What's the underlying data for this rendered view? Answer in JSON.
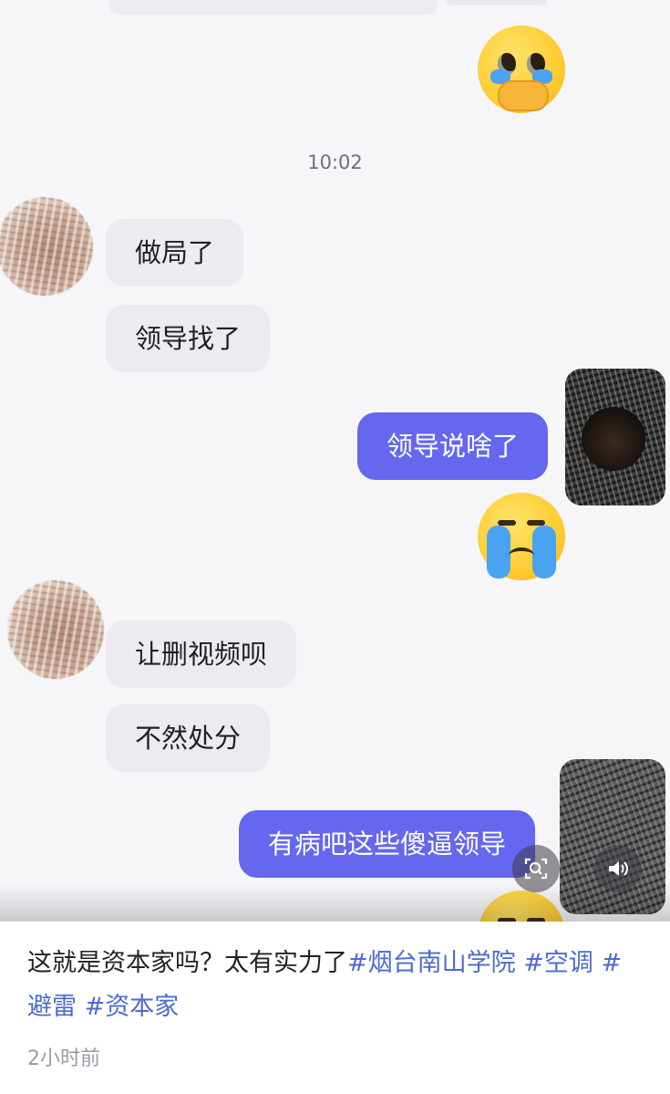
{
  "chat": {
    "timestamp": "10:02",
    "messages": [
      {
        "side": "in",
        "text": "做局了"
      },
      {
        "side": "in",
        "text": "领导找了"
      },
      {
        "side": "out",
        "text": "领导说啥了"
      },
      {
        "side": "in",
        "text": "让删视频呗"
      },
      {
        "side": "in",
        "text": "不然处分"
      },
      {
        "side": "out",
        "text": "有病吧这些傻逼领导"
      }
    ],
    "emojis": [
      "pleading-face-emoji",
      "crying-face-emoji",
      "crying-face-emoji"
    ]
  },
  "controls": {
    "lens_icon": "lens-search-icon",
    "volume_icon": "volume-icon"
  },
  "post": {
    "caption_text": "这就是资本家吗？太有实力了",
    "tags": [
      "#烟台南山学院",
      "#空调",
      "#避雷",
      "#资本家"
    ],
    "time_ago": "2小时前"
  },
  "colors": {
    "outgoing_bubble": "#6567ee",
    "incoming_bubble": "#ebebf0",
    "hashtag": "#4a6bd1"
  }
}
